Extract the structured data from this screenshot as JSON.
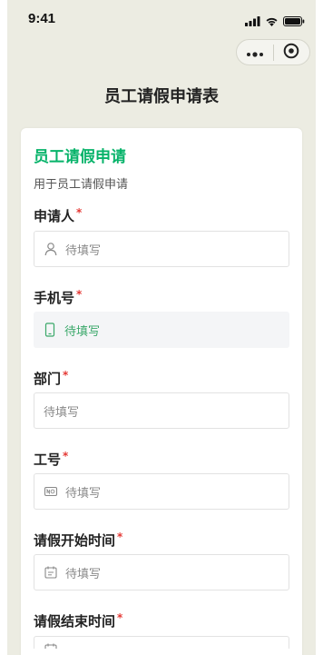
{
  "status_bar": {
    "time": "9:41",
    "icons": [
      "signal-icon",
      "wifi-icon",
      "battery-icon"
    ]
  },
  "capsule": {
    "more_icon": "more-dots-icon",
    "close_icon": "target-close-icon"
  },
  "nav": {
    "title": "员工请假申请表"
  },
  "form": {
    "title": "员工请假申请",
    "description": "用于员工请假申请",
    "fields": [
      {
        "label": "申请人",
        "required_mark": "*",
        "placeholder": "待填写",
        "icon": "person-icon"
      },
      {
        "label": "手机号",
        "required_mark": "*",
        "placeholder": "待填写",
        "icon": "phone-icon"
      },
      {
        "label": "部门",
        "required_mark": "*",
        "placeholder": "待填写",
        "icon": ""
      },
      {
        "label": "工号",
        "required_mark": "*",
        "placeholder": "待填写",
        "icon": "id-card-icon"
      },
      {
        "label": "请假开始时间",
        "required_mark": "*",
        "placeholder": "待填写",
        "icon": "calendar-icon"
      },
      {
        "label": "请假结束时间",
        "required_mark": "*",
        "placeholder": "",
        "icon": "calendar-icon"
      }
    ]
  },
  "colors": {
    "background": "#ecece2",
    "accent": "#07b36a",
    "required": "#e53935"
  }
}
